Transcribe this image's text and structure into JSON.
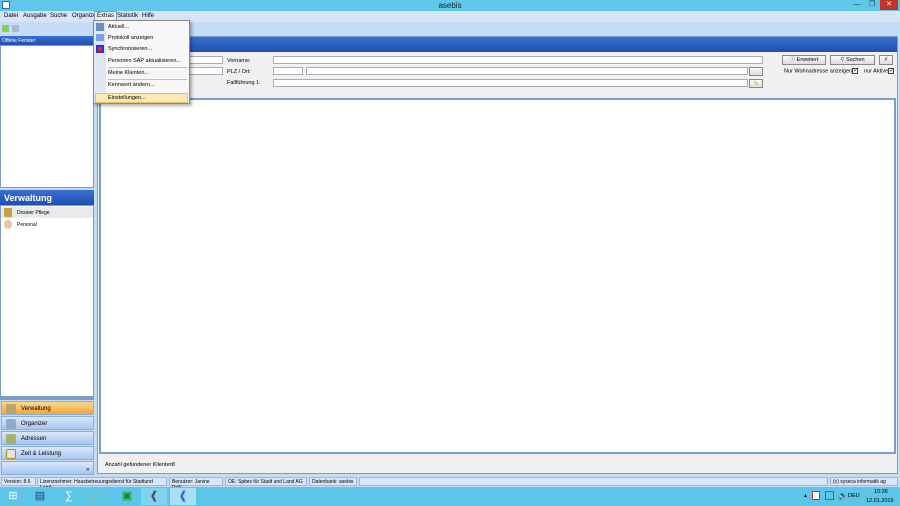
{
  "window": {
    "title": "asebis"
  },
  "menubar": [
    "Datei",
    "Ausgabe",
    "Suche",
    "Organizer",
    "Extras",
    "Statistik",
    "Hilfe"
  ],
  "extras_menu": [
    "Aktuell...",
    "Protokoll anzeigen",
    "Synchronisieren...",
    "Personen SAP aktualisieren...",
    "Meine Klienten...",
    "Kennwort ändern...",
    "Einstellungen..."
  ],
  "left": {
    "open_windows": "Offene Fenster",
    "section_title": "Verwaltung",
    "items": [
      "Dossier Pflege",
      "Personal"
    ],
    "nav": [
      "Verwaltung",
      "Organizer",
      "Adressen",
      "Zeit & Leistung"
    ]
  },
  "main": {
    "title": "Klienten Wahl",
    "vorname": "Vorname:",
    "plz_ort": "PLZ / Ort:",
    "fallfuehrung": "Fallführung 1:",
    "erweitert": "Erweitert",
    "suchen": "Suchen",
    "nur_wohnadresse": "Nur Wohnadresse anzeigen",
    "nur_aktive": "nur Aktive",
    "count_label": "Anzahl gefundener Klienten:",
    "count": "0"
  },
  "status": [
    "Version: 8.6",
    "Lizenznehmer: Hausbetreuungsdienst für Stadtund Land",
    "Benutzer: Janine Pelli",
    "OE: Spitex für Stadt und Land AG",
    "Datenbank: asebis",
    "(c) syseca informatik ag"
  ],
  "tray": {
    "lang": "DEU",
    "time": "10:36",
    "date": "12.01.2016"
  }
}
